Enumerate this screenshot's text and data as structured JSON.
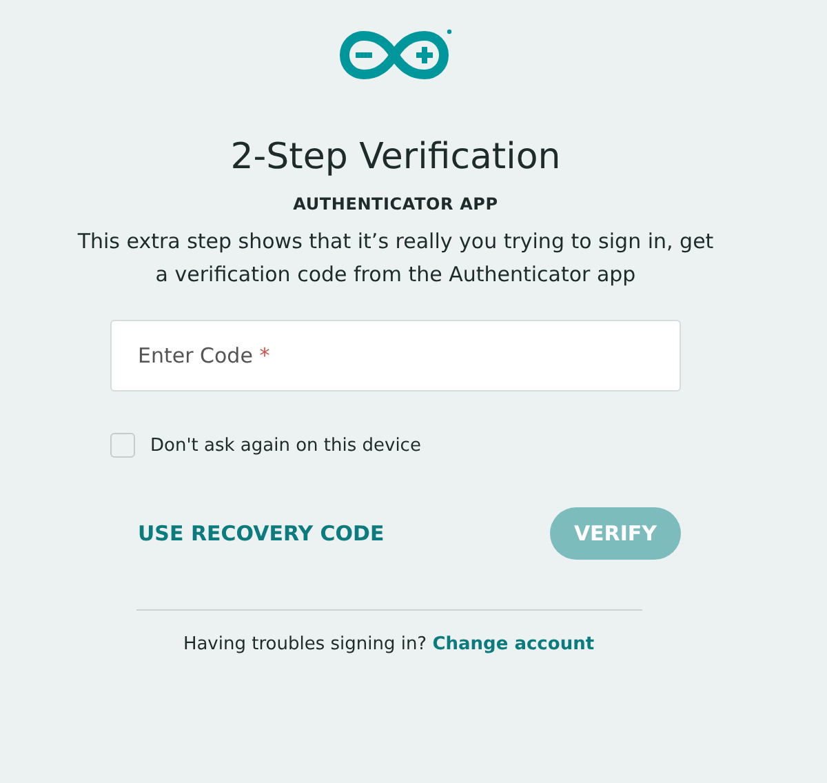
{
  "title": "2-Step Verification",
  "subtitle": "AUTHENTICATOR APP",
  "description": "This extra step shows that it’s really you trying to sign in, get a verification code from the Authenticator app",
  "code_field": {
    "label": "Enter Code",
    "required_mark": "*"
  },
  "remember_checkbox": {
    "label": "Don't ask again on this device",
    "checked": false
  },
  "recovery_link": "USE RECOVERY CODE",
  "verify_button": {
    "label": "VERIFY",
    "disabled": true
  },
  "footer": {
    "text": "Having troubles signing in?",
    "link": "Change account"
  }
}
